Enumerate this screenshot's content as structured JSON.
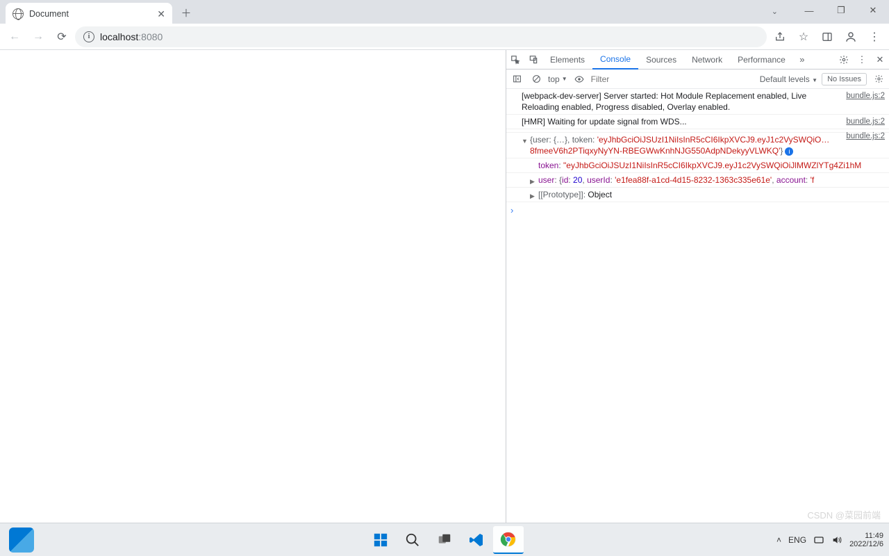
{
  "browser": {
    "tab_title": "Document",
    "url_host": "localhost",
    "url_port": ":8080"
  },
  "devtools": {
    "tabs": [
      "Elements",
      "Console",
      "Sources",
      "Network",
      "Performance"
    ],
    "active_tab": "Console",
    "context": "top",
    "filter_placeholder": "Filter",
    "levels": "Default levels",
    "issues": "No Issues"
  },
  "console": {
    "src": "bundle.js:2",
    "msg1": "[webpack-dev-server] Server started: Hot Module Replacement enabled, Live Reloading enabled, Progress disabled, Overlay enabled.",
    "msg2": "[HMR] Waiting for update signal from WDS...",
    "obj_preview_a": "{user: {…}, token: ",
    "obj_preview_token": "'eyJhbGciOiJSUzI1NiIsInR5cCI6IkpXVCJ9.eyJ1c2VySWQiO…8fmeeV6h2PTiqxyNyYN-RBEGWwKnhNJG550AdpNDekyyVLWKQ'",
    "token_key": "token",
    "token_val": "\"eyJhbGciOiJSUzI1NiIsInR5cCI6IkpXVCJ9.eyJ1c2VySWQiOiJlMWZlYTg4Zi1hM",
    "user_key": "user",
    "user_id_key": "id",
    "user_id_val": "20",
    "user_uid_key": "userId",
    "user_uid_val": "'e1fea88f-a1cd-4d15-8232-1363c335e61e'",
    "user_acc_key": "account",
    "user_acc_val": "'f",
    "proto_key": "[[Prototype]]",
    "proto_val": "Object"
  },
  "taskbar": {
    "lang": "ENG",
    "time": "11:49",
    "date": "2022/12/6"
  },
  "watermark": "CSDN @菜园前端"
}
